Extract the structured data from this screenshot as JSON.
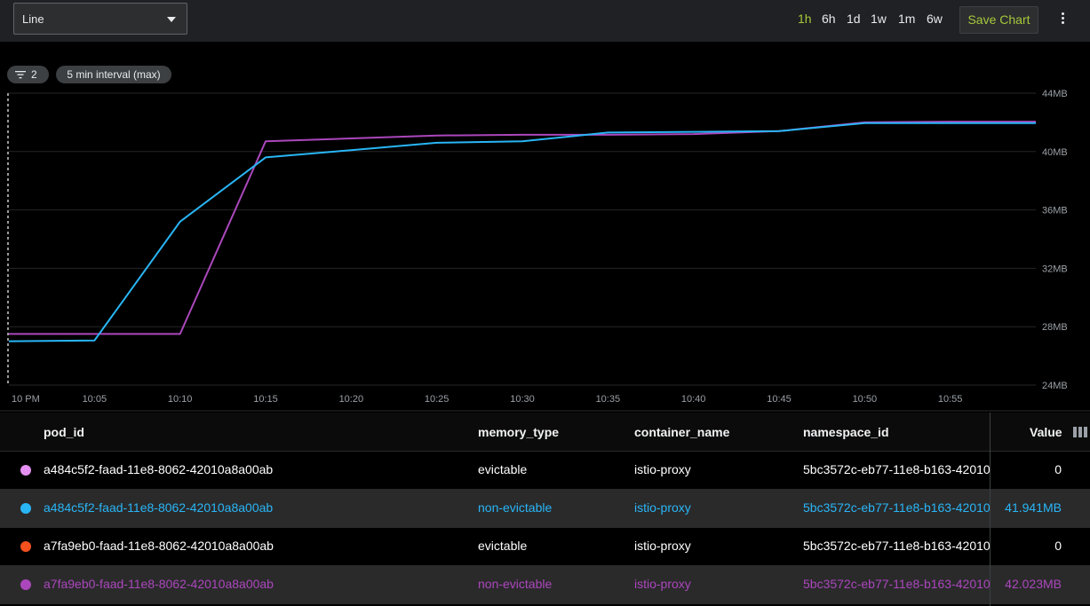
{
  "toolbar": {
    "chart_type": "Line",
    "ranges": [
      "1h",
      "6h",
      "1d",
      "1w",
      "1m",
      "6w"
    ],
    "active_range": "1h",
    "save_label": "Save Chart",
    "accent": "#a6c83a"
  },
  "chips": {
    "filter_count": "2",
    "interval": "5 min interval (max)"
  },
  "chart_data": {
    "type": "line",
    "x_ticks": [
      "10 PM",
      "10:05",
      "10:10",
      "10:15",
      "10:20",
      "10:25",
      "10:30",
      "10:35",
      "10:40",
      "10:45",
      "10:50",
      "10:55"
    ],
    "y_ticks": [
      "24MB",
      "28MB",
      "32MB",
      "36MB",
      "40MB",
      "44MB"
    ],
    "ylim": [
      24,
      44
    ],
    "y_unit": "MB",
    "grid": true,
    "series": [
      {
        "color": "#ab47bc",
        "x": [
          "10 PM",
          "10:05",
          "10:10",
          "10:15",
          "10:20",
          "10:25",
          "10:30",
          "10:35",
          "10:40",
          "10:45",
          "10:50",
          "10:55",
          "11 PM"
        ],
        "values": [
          27.5,
          27.5,
          27.5,
          40.7,
          40.9,
          41.1,
          41.15,
          41.15,
          41.2,
          41.4,
          42.0,
          42.05,
          42.05
        ]
      },
      {
        "color": "#29b6f6",
        "x": [
          "10 PM",
          "10:05",
          "10:10",
          "10:15",
          "10:20",
          "10:25",
          "10:30",
          "10:35",
          "10:40",
          "10:45",
          "10:50",
          "10:55",
          "11 PM"
        ],
        "values": [
          27.0,
          27.05,
          35.2,
          39.6,
          40.1,
          40.6,
          40.7,
          41.3,
          41.35,
          41.4,
          41.95,
          41.95,
          41.95
        ]
      }
    ]
  },
  "table": {
    "headers": [
      "pod_id",
      "memory_type",
      "container_name",
      "namespace_id",
      "Value"
    ],
    "rows": [
      {
        "color": "#e58ff3",
        "text_color": "#ffffff",
        "pod_id": "a484c5f2-faad-11e8-8062-42010a8a00ab",
        "memory_type": "evictable",
        "container_name": "istio-proxy",
        "namespace_id": "5bc3572c-eb77-11e8-b163-42010",
        "value": "0"
      },
      {
        "color": "#29b6f6",
        "text_color": "#29b6f6",
        "pod_id": "a484c5f2-faad-11e8-8062-42010a8a00ab",
        "memory_type": "non-evictable",
        "container_name": "istio-proxy",
        "namespace_id": "5bc3572c-eb77-11e8-b163-42010",
        "value": "41.941MB"
      },
      {
        "color": "#f4511e",
        "text_color": "#ffffff",
        "pod_id": "a7fa9eb0-faad-11e8-8062-42010a8a00ab",
        "memory_type": "evictable",
        "container_name": "istio-proxy",
        "namespace_id": "5bc3572c-eb77-11e8-b163-42010",
        "value": "0"
      },
      {
        "color": "#ab47bc",
        "text_color": "#ab47bc",
        "pod_id": "a7fa9eb0-faad-11e8-8062-42010a8a00ab",
        "memory_type": "non-evictable",
        "container_name": "istio-proxy",
        "namespace_id": "5bc3572c-eb77-11e8-b163-42010",
        "value": "42.023MB"
      }
    ]
  }
}
